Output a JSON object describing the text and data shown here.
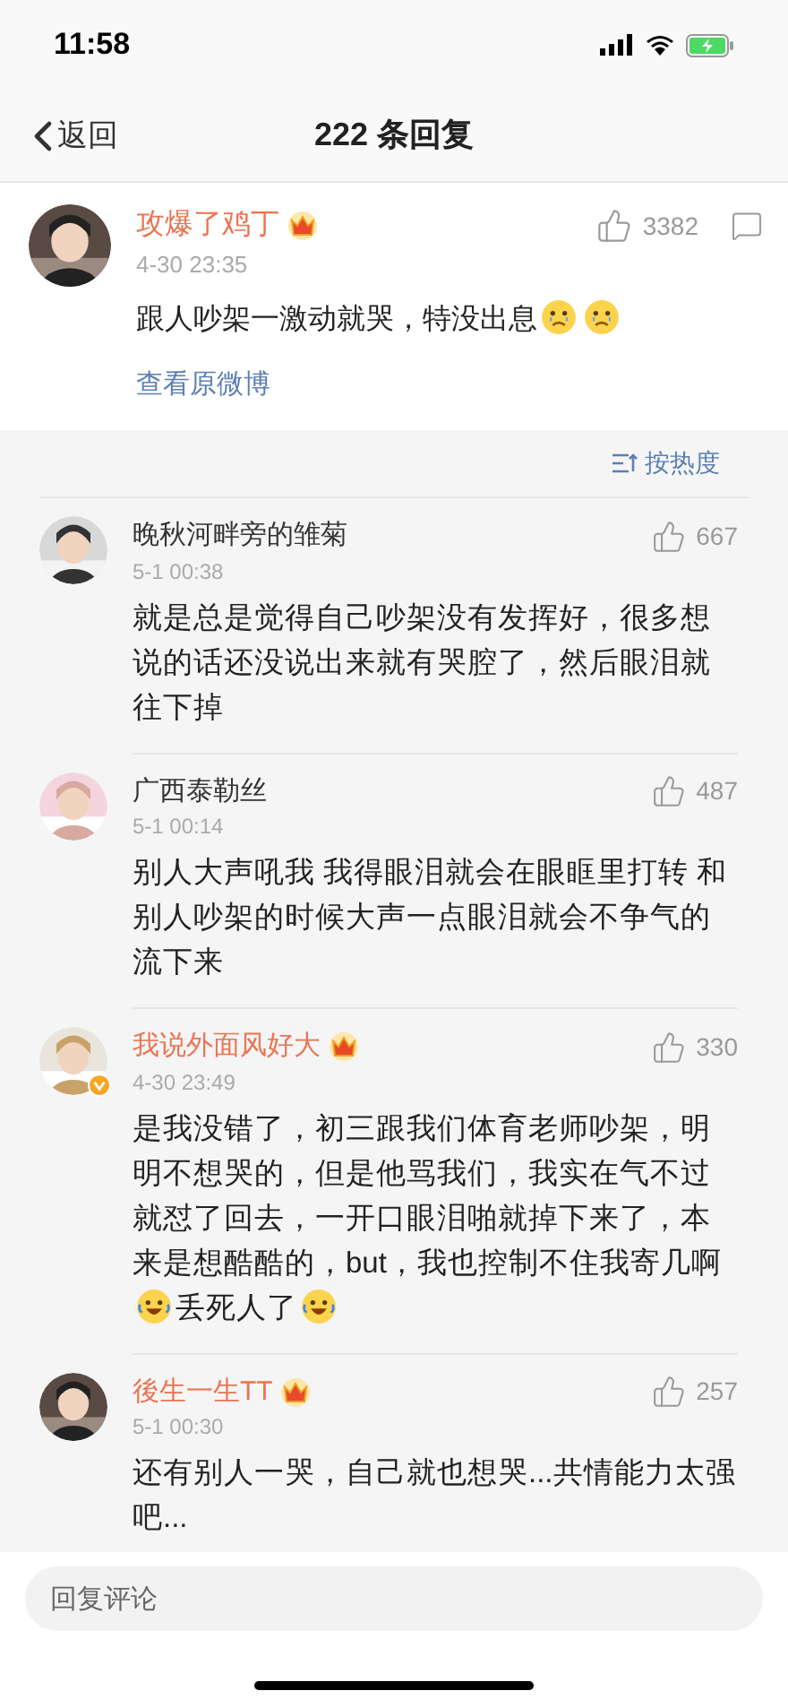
{
  "status_bar": {
    "time": "11:58"
  },
  "nav": {
    "back": "返回",
    "title": "222 条回复"
  },
  "post": {
    "author": "攻爆了鸡丁",
    "vip": true,
    "time": "4-30 23:35",
    "likes": "3382",
    "content": [
      {
        "kind": "text",
        "text": "跟人吵架一激动就哭，特没出息"
      },
      {
        "kind": "sad-emoji"
      },
      {
        "kind": "sad-emoji"
      }
    ],
    "link": "查看原微博"
  },
  "sort": {
    "label": "按热度"
  },
  "comments": [
    {
      "author": "晚秋河畔旁的雏菊",
      "vip": false,
      "verified": false,
      "time": "5-1 00:38",
      "likes": "667",
      "content": [
        {
          "kind": "text",
          "text": "就是总是觉得自己吵架没有发挥好，很多想说的话还没说出来就有哭腔了，然后眼泪就往下掉"
        }
      ]
    },
    {
      "author": "广西泰勒丝",
      "vip": false,
      "verified": false,
      "time": "5-1 00:14",
      "likes": "487",
      "content": [
        {
          "kind": "text",
          "text": "别人大声吼我 我得眼泪就会在眼眶里打转 和别人吵架的时候大声一点眼泪就会不争气的流下来"
        }
      ]
    },
    {
      "author": "我说外面风好大",
      "vip": true,
      "verified": true,
      "time": "4-30 23:49",
      "likes": "330",
      "content": [
        {
          "kind": "text",
          "text": "是我没错了，初三跟我们体育老师吵架，明明不想哭的，但是他骂我们，我实在气不过就怼了回去，一开口眼泪啪就掉下来了，本来是想酷酷的，but，我也控制不住我寄几啊"
        },
        {
          "kind": "laugh-emoji"
        },
        {
          "kind": "text",
          "text": "丢死人了"
        },
        {
          "kind": "laugh-emoji"
        }
      ]
    },
    {
      "author": "後生一生TT",
      "vip": true,
      "verified": false,
      "time": "5-1 00:30",
      "likes": "257",
      "content": [
        {
          "kind": "text",
          "text": "还有别人一哭，自己就也想哭...共情能力太强吧..."
        }
      ]
    }
  ],
  "reply": {
    "placeholder": "回复评论"
  }
}
